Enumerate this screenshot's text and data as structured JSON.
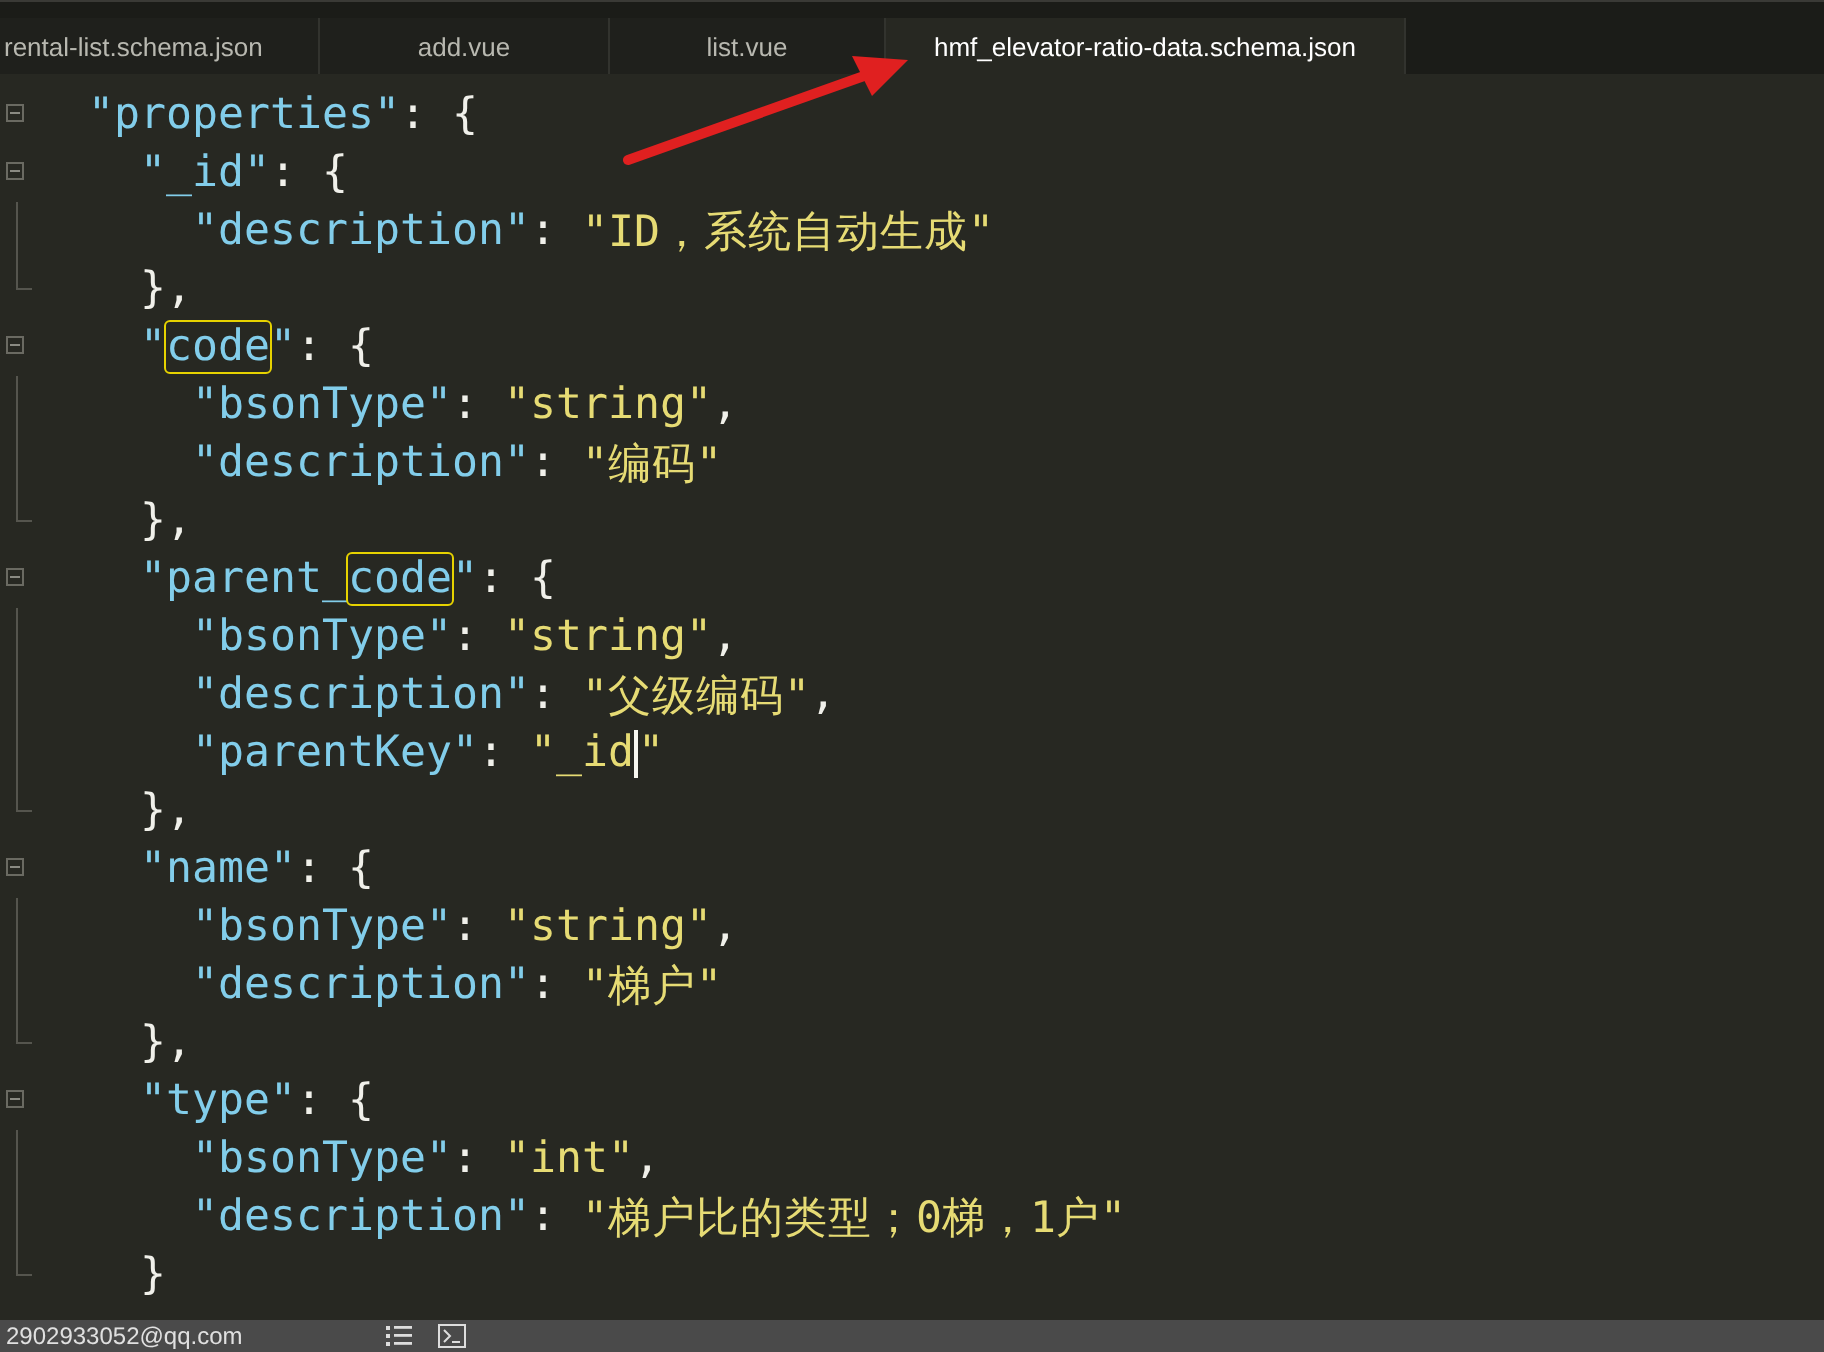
{
  "tabs": [
    {
      "label": "rental-list.schema.json",
      "selected": false
    },
    {
      "label": "add.vue",
      "selected": false
    },
    {
      "label": "list.vue",
      "selected": false
    },
    {
      "label": "hmf_elevator-ratio-data.schema.json",
      "selected": true
    }
  ],
  "editor": {
    "lines": [
      {
        "segments": [
          {
            "kind": "key",
            "text": "\"properties\""
          },
          {
            "kind": "punct",
            "text": ": {"
          }
        ],
        "expanded": true,
        "children": [
          {
            "segments": [
              {
                "kind": "key",
                "text": "\"_id\""
              },
              {
                "kind": "punct",
                "text": ": {"
              }
            ],
            "expanded": true,
            "children": [
              {
                "segments": [
                  {
                    "kind": "key",
                    "text": "\"description\""
                  },
                  {
                    "kind": "punct",
                    "text": ": "
                  },
                  {
                    "kind": "str",
                    "text": "\"ID，系统自动生成\""
                  }
                ]
              }
            ]
          },
          {
            "segments": [
              {
                "kind": "punct",
                "text": "},"
              }
            ]
          },
          {
            "segments": [
              {
                "kind": "key",
                "text": "\""
              },
              {
                "kind": "boxed",
                "text": "code"
              },
              {
                "kind": "key",
                "text": "\""
              },
              {
                "kind": "punct",
                "text": ": {"
              }
            ],
            "expanded": true,
            "children": [
              {
                "segments": [
                  {
                    "kind": "key",
                    "text": "\"bsonType\""
                  },
                  {
                    "kind": "punct",
                    "text": ": "
                  },
                  {
                    "kind": "str",
                    "text": "\"string\""
                  },
                  {
                    "kind": "punct",
                    "text": ","
                  }
                ]
              },
              {
                "segments": [
                  {
                    "kind": "key",
                    "text": "\"description\""
                  },
                  {
                    "kind": "punct",
                    "text": ": "
                  },
                  {
                    "kind": "str",
                    "text": "\"编码\""
                  }
                ]
              }
            ]
          },
          {
            "segments": [
              {
                "kind": "punct",
                "text": "},"
              }
            ]
          },
          {
            "segments": [
              {
                "kind": "key",
                "text": "\"parent_"
              },
              {
                "kind": "boxed",
                "text": "code"
              },
              {
                "kind": "key",
                "text": "\""
              },
              {
                "kind": "punct",
                "text": ": {"
              }
            ],
            "expanded": true,
            "children": [
              {
                "segments": [
                  {
                    "kind": "key",
                    "text": "\"bsonType\""
                  },
                  {
                    "kind": "punct",
                    "text": ": "
                  },
                  {
                    "kind": "str",
                    "text": "\"string\""
                  },
                  {
                    "kind": "punct",
                    "text": ","
                  }
                ]
              },
              {
                "segments": [
                  {
                    "kind": "key",
                    "text": "\"description\""
                  },
                  {
                    "kind": "punct",
                    "text": ": "
                  },
                  {
                    "kind": "str",
                    "text": "\"父级编码\""
                  },
                  {
                    "kind": "punct",
                    "text": ","
                  }
                ]
              },
              {
                "segments": [
                  {
                    "kind": "key",
                    "text": "\"parentKey\""
                  },
                  {
                    "kind": "punct",
                    "text": ": "
                  },
                  {
                    "kind": "str",
                    "text": "\"_id"
                  },
                  {
                    "kind": "cursor"
                  },
                  {
                    "kind": "str",
                    "text": "\""
                  }
                ]
              }
            ]
          },
          {
            "segments": [
              {
                "kind": "punct",
                "text": "},"
              }
            ]
          },
          {
            "segments": [
              {
                "kind": "key",
                "text": "\"name\""
              },
              {
                "kind": "punct",
                "text": ": {"
              }
            ],
            "expanded": true,
            "children": [
              {
                "segments": [
                  {
                    "kind": "key",
                    "text": "\"bsonType\""
                  },
                  {
                    "kind": "punct",
                    "text": ": "
                  },
                  {
                    "kind": "str",
                    "text": "\"string\""
                  },
                  {
                    "kind": "punct",
                    "text": ","
                  }
                ]
              },
              {
                "segments": [
                  {
                    "kind": "key",
                    "text": "\"description\""
                  },
                  {
                    "kind": "punct",
                    "text": ": "
                  },
                  {
                    "kind": "str",
                    "text": "\"梯户\""
                  }
                ]
              }
            ]
          },
          {
            "segments": [
              {
                "kind": "punct",
                "text": "},"
              }
            ]
          },
          {
            "segments": [
              {
                "kind": "key",
                "text": "\"type\""
              },
              {
                "kind": "punct",
                "text": ": {"
              }
            ],
            "expanded": true,
            "children": [
              {
                "segments": [
                  {
                    "kind": "key",
                    "text": "\"bsonType\""
                  },
                  {
                    "kind": "punct",
                    "text": ": "
                  },
                  {
                    "kind": "str",
                    "text": "\"int\""
                  },
                  {
                    "kind": "punct",
                    "text": ","
                  }
                ]
              },
              {
                "segments": [
                  {
                    "kind": "key",
                    "text": "\"description\""
                  },
                  {
                    "kind": "punct",
                    "text": ": "
                  },
                  {
                    "kind": "str",
                    "text": "\"梯户比的类型；0梯，1户\""
                  }
                ]
              }
            ]
          },
          {
            "segments": [
              {
                "kind": "punct",
                "text": "}"
              }
            ]
          }
        ]
      }
    ]
  },
  "status_bar": {
    "text": "2902933052@qq.com"
  }
}
